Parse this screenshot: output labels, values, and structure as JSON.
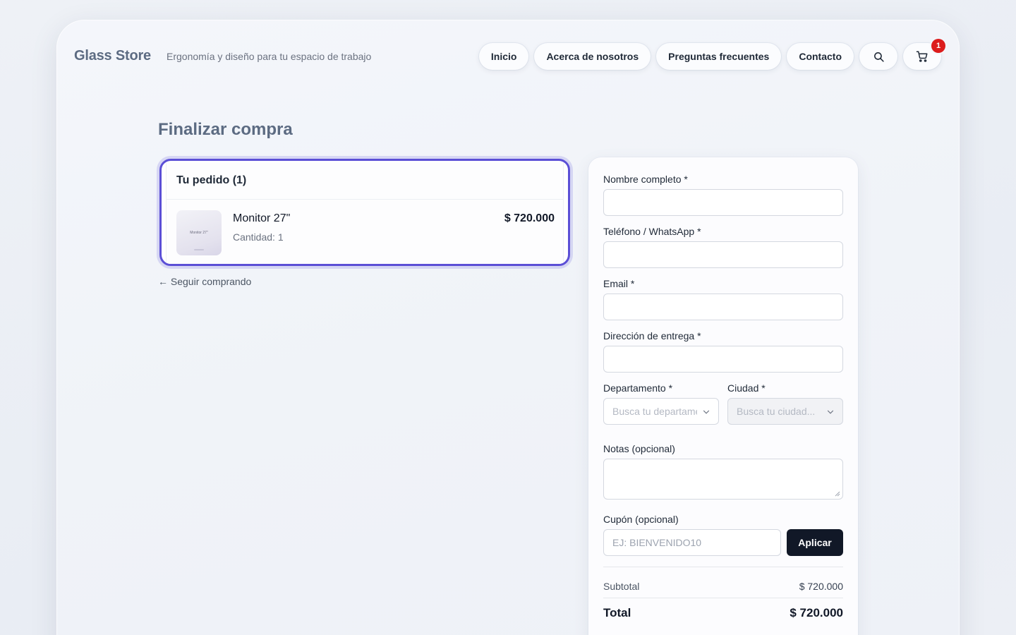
{
  "header": {
    "brand": "Glass Store",
    "tagline": "Ergonomía y diseño para tu espacio de trabajo",
    "nav": [
      "Inicio",
      "Acerca de nosotros",
      "Preguntas frecuentes",
      "Contacto"
    ],
    "cart_count": "1",
    "icons": {
      "search": "search-icon",
      "cart": "cart-icon"
    }
  },
  "page": {
    "title": "Finalizar compra"
  },
  "order": {
    "heading": "Tu pedido (1)",
    "item": {
      "name": "Monitor 27\"",
      "quantity": "Cantidad: 1",
      "price": "$ 720.000",
      "thumb_text": "Monitor 27\""
    },
    "back_link": "← Seguir comprando"
  },
  "form": {
    "name_label": "Nombre completo *",
    "phone_label": "Teléfono / WhatsApp *",
    "email_label": "Email *",
    "address_label": "Dirección de entrega *",
    "department_label": "Departamento *",
    "department_placeholder": "Busca tu departamento...",
    "city_label": "Ciudad *",
    "city_placeholder": "Busca tu ciudad...",
    "notes_label": "Notas (opcional)",
    "coupon_label": "Cupón (opcional)",
    "coupon_placeholder": "EJ: BIENVENIDO10",
    "apply_label": "Aplicar"
  },
  "summary": {
    "subtotal_label": "Subtotal",
    "subtotal_value": "$ 720.000",
    "total_label": "Total",
    "total_value": "$ 720.000"
  },
  "colors": {
    "accent": "#5b4fd6",
    "badge": "#dc1c1c",
    "button": "#111827"
  }
}
